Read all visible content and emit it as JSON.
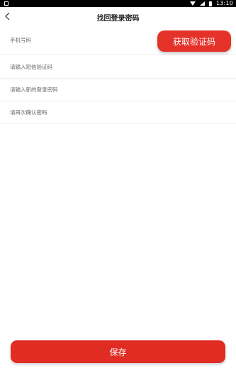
{
  "status_bar": {
    "time": "13:10"
  },
  "header": {
    "title": "找回登录密码"
  },
  "form": {
    "phone_placeholder": "手机号码",
    "code_placeholder": "请输入短信验证码",
    "new_password_placeholder": "请输入新的登录密码",
    "confirm_password_placeholder": "请再次确认密码",
    "get_code_label": "获取验证码"
  },
  "save_label": "保存",
  "colors": {
    "accent": "#e53229"
  }
}
